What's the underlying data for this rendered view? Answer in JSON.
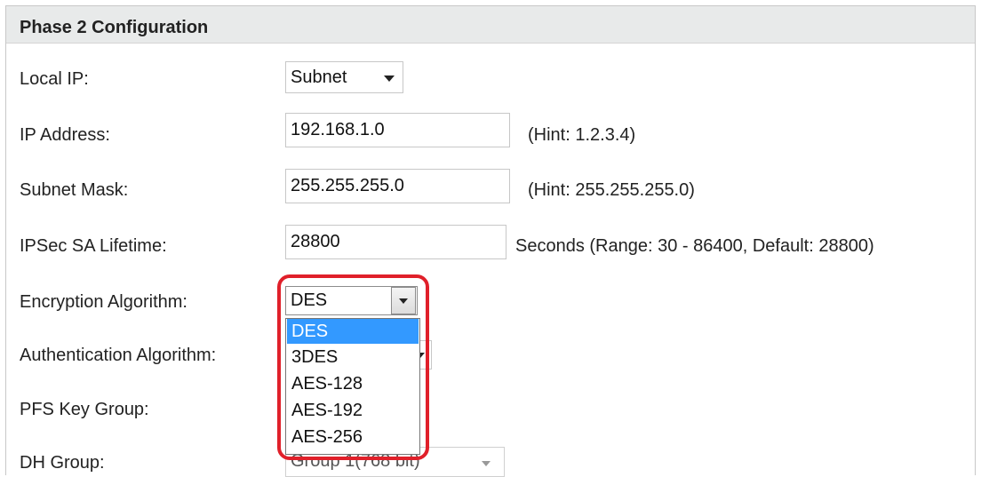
{
  "header": {
    "title": "Phase 2 Configuration"
  },
  "fields": {
    "local_ip": {
      "label": "Local IP:",
      "value": "Subnet"
    },
    "ip_address": {
      "label": "IP Address:",
      "value": "192.168.1.0",
      "hint": "(Hint: 1.2.3.4)"
    },
    "subnet_mask": {
      "label": "Subnet Mask:",
      "value": "255.255.255.0",
      "hint": "(Hint: 255.255.255.0)"
    },
    "ipsec_lifetime": {
      "label": "IPSec SA Lifetime:",
      "value": "28800",
      "hint": "Seconds  (Range: 30 - 86400, Default: 28800)"
    },
    "encryption": {
      "label": "Encryption Algorithm:",
      "value": "DES",
      "options": [
        "DES",
        "3DES",
        "AES-128",
        "AES-192",
        "AES-256"
      ],
      "selected_option": "DES"
    },
    "authentication": {
      "label": "Authentication Algorithm:"
    },
    "pfs_key_group": {
      "label": "PFS Key Group:"
    },
    "dh_group": {
      "label": "DH Group:",
      "value": "Group 1(768 bit)"
    }
  },
  "annotation": {
    "highlight_color": "#e0202a"
  },
  "colors": {
    "selection": "#3399ff",
    "header_bg": "#e8eaea"
  }
}
